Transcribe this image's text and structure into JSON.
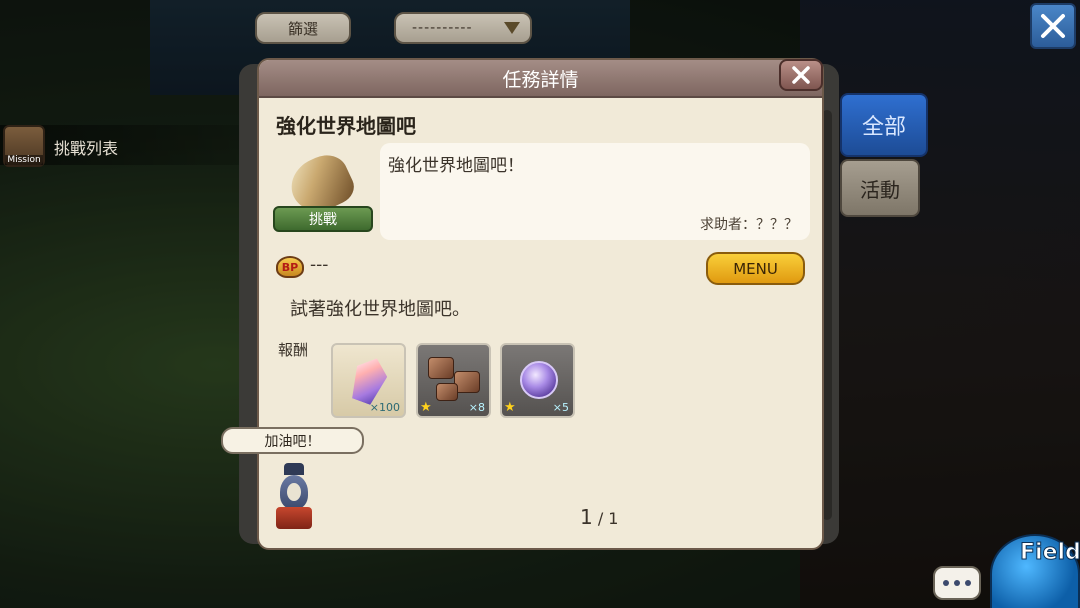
{
  "toolbar": {
    "filter_label": "篩選",
    "filter_select_value": "----------"
  },
  "sidebar": {
    "mission_icon_text": "Mission",
    "mission_list_label": "挑戰列表"
  },
  "tabs": [
    {
      "label": "全部",
      "active": true
    },
    {
      "label": "活動",
      "active": false
    }
  ],
  "dialog": {
    "header_title": "任務詳情",
    "mission_title": "強化世界地圖吧",
    "emblem_label": "挑戰",
    "description": "強化世界地圖吧！",
    "requester": "求助者：？？？",
    "bp_icon_text": "BP",
    "bp_value": "---",
    "menu_label": "MENU",
    "objective": "試著強化世界地圖吧。",
    "rewards_label": "報酬",
    "rewards": [
      {
        "item_icon": "crystal-icon",
        "count": "×100",
        "starred": false
      },
      {
        "item_icon": "ore-icon",
        "count": "×8",
        "starred": true
      },
      {
        "item_icon": "orb-icon",
        "count": "×5",
        "starred": true
      }
    ],
    "mascot_speech": "加油吧！",
    "page_current": "1",
    "page_total": "/ 1"
  },
  "bottom": {
    "field_label": "Field"
  },
  "colors": {
    "active_tab": "#2f6fd0",
    "menu_button": "#f9cf3a",
    "dialog_background": "#f1ead8",
    "dialog_header": "#a48d86"
  }
}
